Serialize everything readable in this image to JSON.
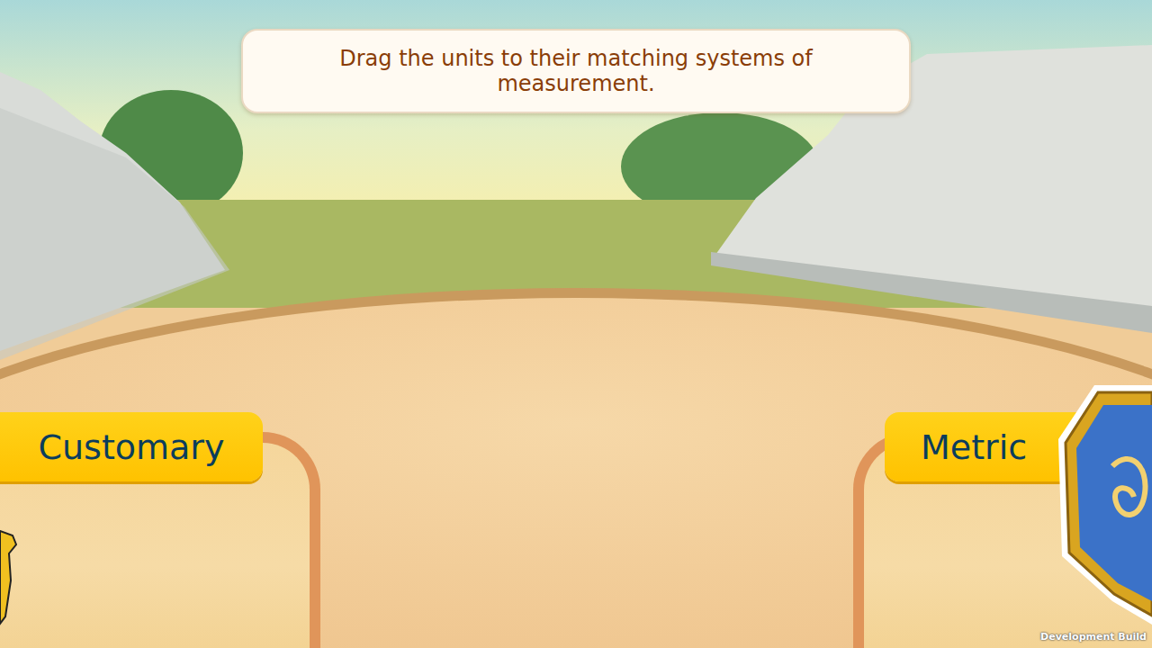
{
  "instruction": "Drag the units to their matching systems of measurement.",
  "zones": [
    {
      "label": "Customary",
      "side": "left"
    },
    {
      "label": "Metric",
      "side": "right"
    }
  ],
  "build_label": "Development Build"
}
